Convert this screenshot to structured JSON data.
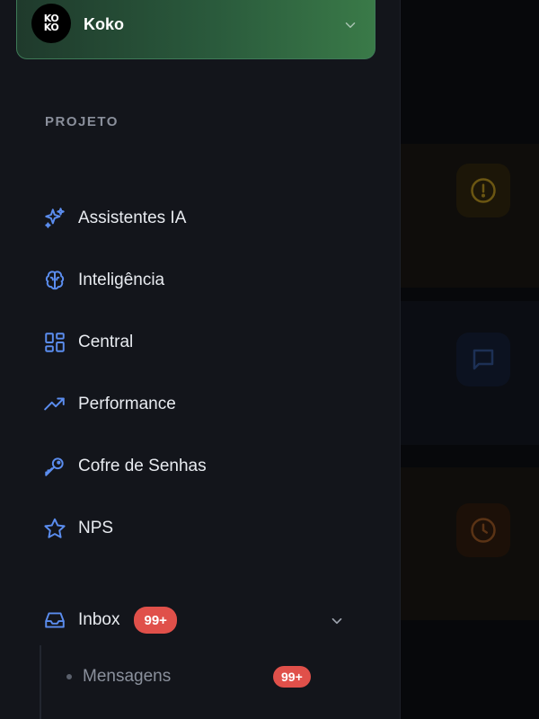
{
  "project_switcher": {
    "avatar_text_top": "KO",
    "avatar_text_bottom": "KO",
    "name": "Koko",
    "chevron_icon": "chevron-down-icon"
  },
  "sidebar": {
    "section_label": "PROJETO",
    "items": [
      {
        "label": "Assistentes IA",
        "icon": "sparkles-icon"
      },
      {
        "label": "Inteligência",
        "icon": "brain-icon"
      },
      {
        "label": "Central",
        "icon": "layout-grid-icon"
      },
      {
        "label": "Performance",
        "icon": "trending-up-icon"
      },
      {
        "label": "Cofre de Senhas",
        "icon": "key-icon"
      },
      {
        "label": "NPS",
        "icon": "star-icon"
      }
    ],
    "inbox": {
      "label": "Inbox",
      "badge": "99+",
      "icon": "inbox-icon",
      "chevron_icon": "chevron-down-icon",
      "sub_items": [
        {
          "label": "Mensagens",
          "badge": "99+"
        }
      ]
    }
  },
  "background_icons": [
    "alert-circle-icon",
    "message-square-icon",
    "clock-icon"
  ],
  "colors": {
    "accent_blue": "#5b8def",
    "badge_red": "#e0504a",
    "switcher_green": "#2a5a3c"
  }
}
